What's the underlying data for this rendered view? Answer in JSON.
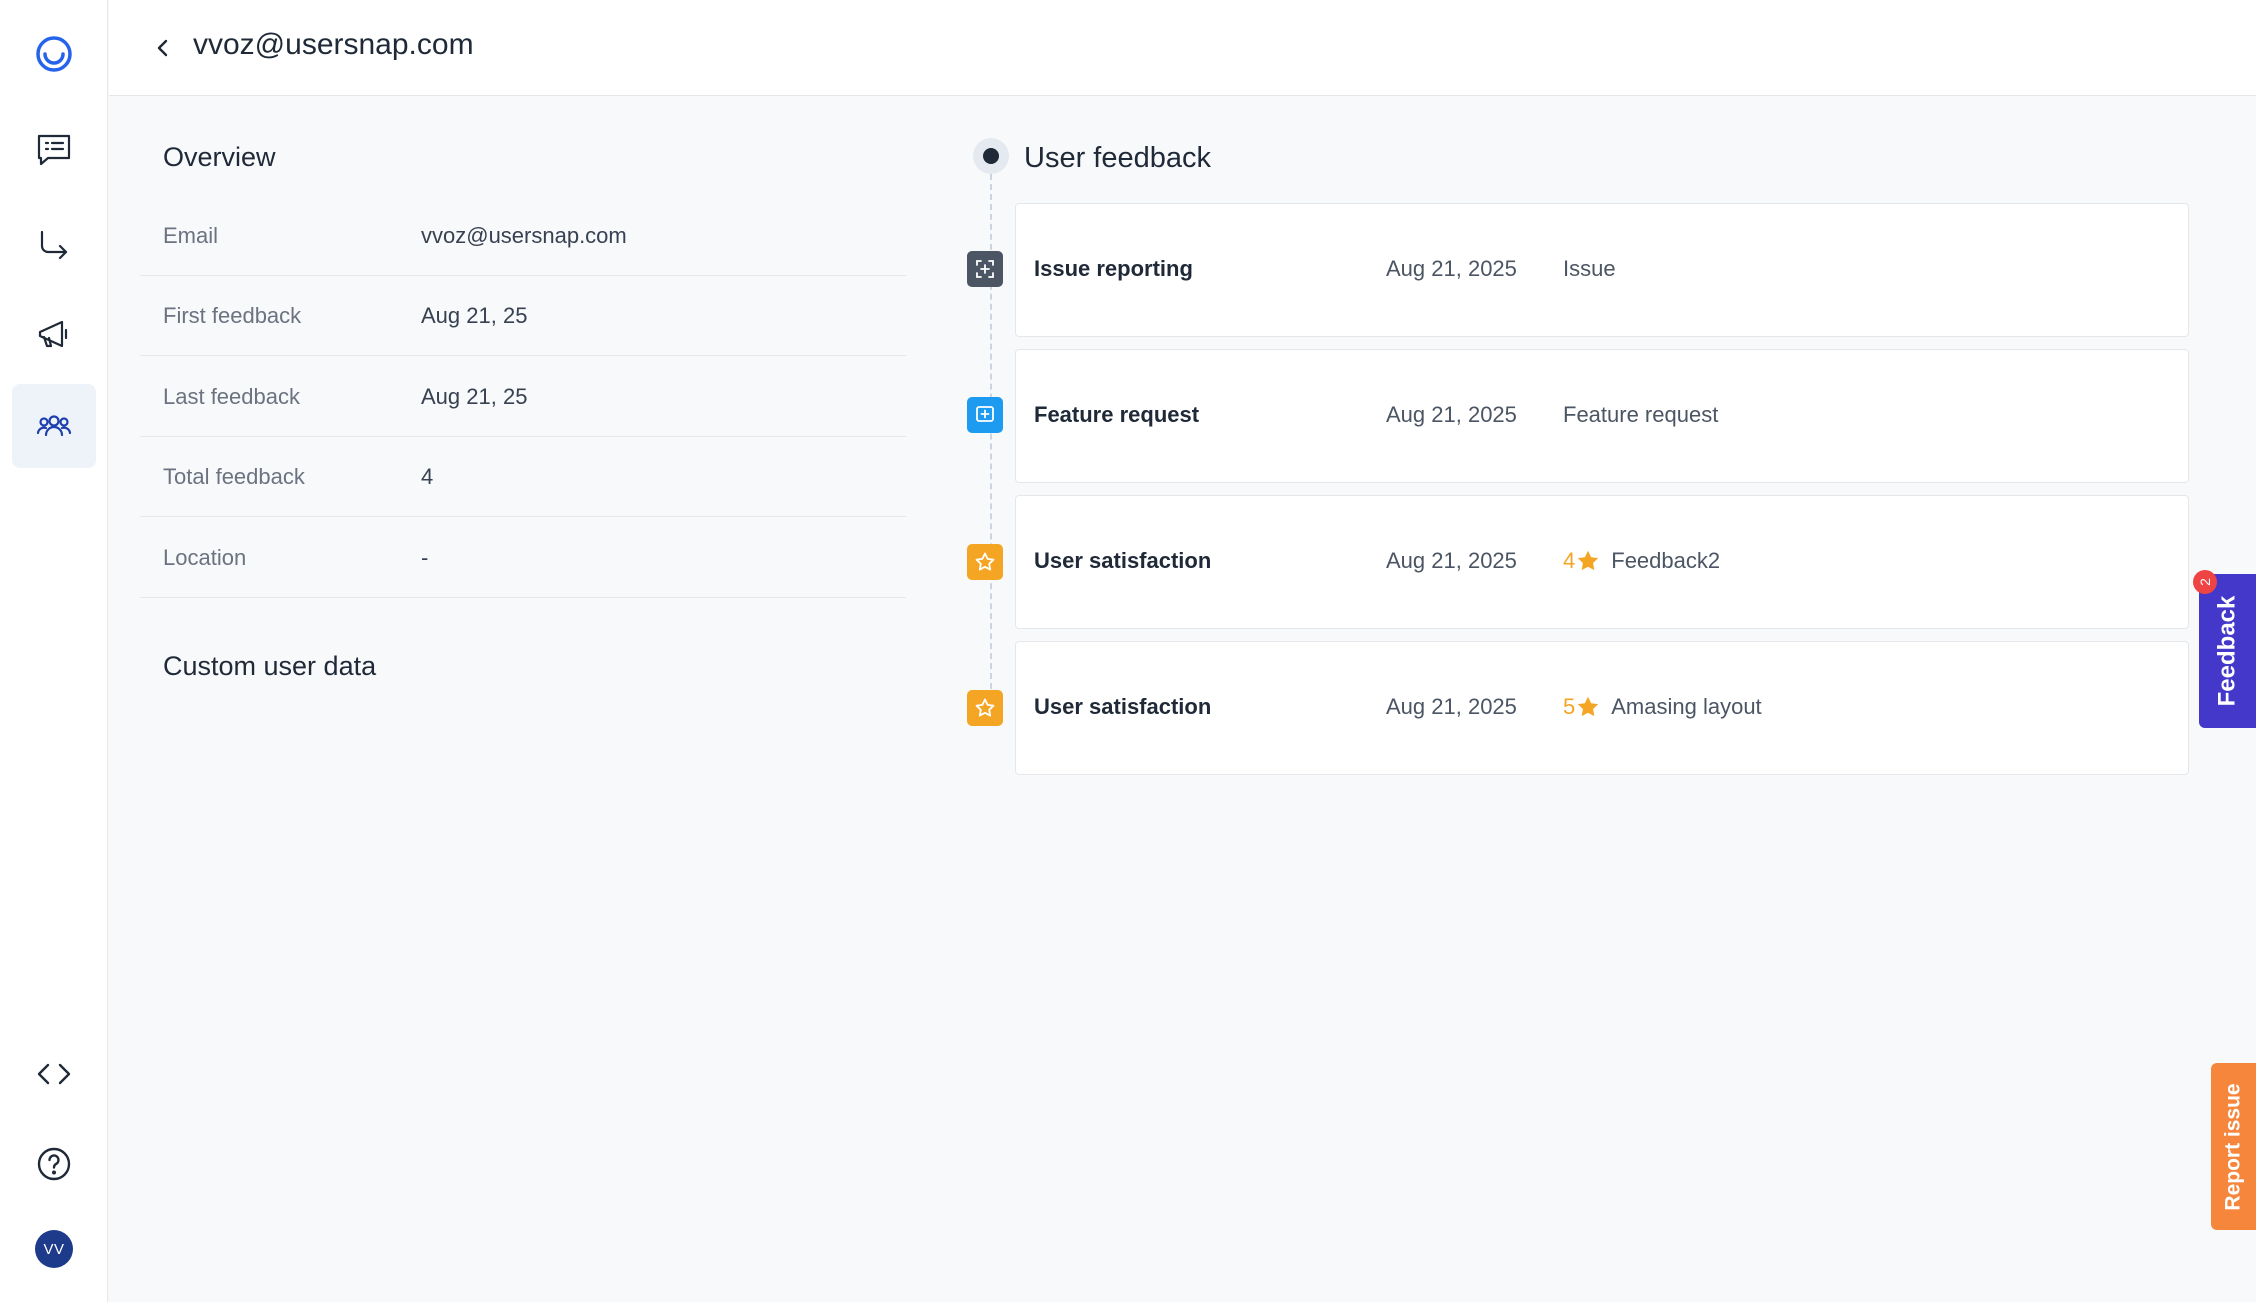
{
  "header": {
    "title": "vvoz@usersnap.com"
  },
  "sidebar": {
    "items": [
      {
        "name": "feedback",
        "icon": "message-list-icon"
      },
      {
        "name": "workflows",
        "icon": "route-arrow-icon"
      },
      {
        "name": "announcements",
        "icon": "megaphone-icon"
      },
      {
        "name": "users",
        "icon": "users-icon",
        "active": true
      }
    ],
    "bottom": [
      {
        "name": "code",
        "icon": "code-icon"
      },
      {
        "name": "help",
        "icon": "help-circle-icon"
      }
    ],
    "avatar": "VV"
  },
  "overview": {
    "title": "Overview",
    "rows": [
      {
        "label": "Email",
        "value": "vvoz@usersnap.com"
      },
      {
        "label": "First feedback",
        "value": "Aug 21, 25"
      },
      {
        "label": "Last feedback",
        "value": "Aug 21, 25"
      },
      {
        "label": "Total feedback",
        "value": "4"
      },
      {
        "label": "Location",
        "value": "-"
      }
    ],
    "custom_title": "Custom user data"
  },
  "timeline": {
    "title": "User feedback",
    "items": [
      {
        "name": "Issue reporting",
        "date": "Aug 21, 2025",
        "type": "Issue",
        "icon": "screenshot-plus-icon",
        "icon_color": "#4b5563"
      },
      {
        "name": "Feature request",
        "date": "Aug 21, 2025",
        "type": "Feature request",
        "icon": "plus-square-icon",
        "icon_color": "#1d9bf0"
      },
      {
        "name": "User satisfaction",
        "date": "Aug 21, 2025",
        "rating": "4",
        "type": "Feedback2",
        "icon": "star-icon",
        "icon_color": "#f5a524"
      },
      {
        "name": "User satisfaction",
        "date": "Aug 21, 2025",
        "rating": "5",
        "type": "Amasing layout",
        "icon": "star-icon",
        "icon_color": "#f5a524"
      }
    ]
  },
  "widgets": {
    "feedback_label": "Feedback",
    "feedback_badge": "2",
    "report_label": "Report issue"
  },
  "colors": {
    "accent": "#1e3a8a",
    "feedback_tab": "#4338ca",
    "report_tab": "#f5863c",
    "rating": "#f5a524"
  }
}
